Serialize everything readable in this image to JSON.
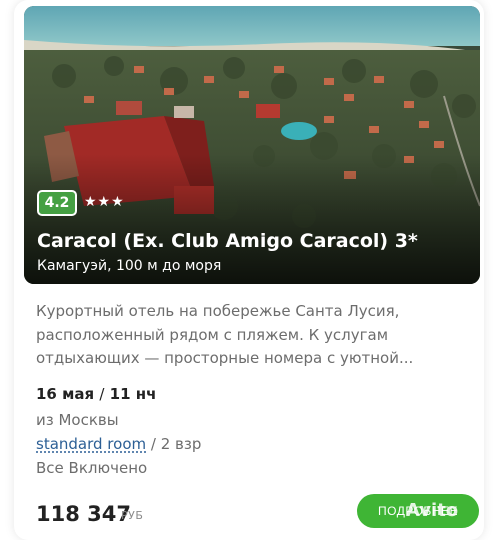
{
  "hotel": {
    "rating": "4.2",
    "stars": "★★★",
    "name": "Caracol (Ex. Club Amigo Caracol) 3*",
    "location": "Камагуэй, 100 м до моря"
  },
  "description": "Курортный отель на побережье Санта Лусия, расположенный рядом с пляжем. К услугам отдыхающих — просторные номера с уютной...",
  "tour": {
    "date": "16 мая",
    "separator": "/",
    "nights": "11 нч",
    "departure": "из Москвы",
    "room_type": "standard room",
    "guests": "/ 2 взр",
    "meal": "Все Включено"
  },
  "price": {
    "amount": "118 347",
    "currency": "РУБ"
  },
  "button": {
    "label": "ПОДРОБНЕЕ"
  },
  "watermark": "Avito",
  "colors": {
    "rating_badge": "#45a043",
    "button": "#3fb535",
    "link": "#2c5f95"
  }
}
